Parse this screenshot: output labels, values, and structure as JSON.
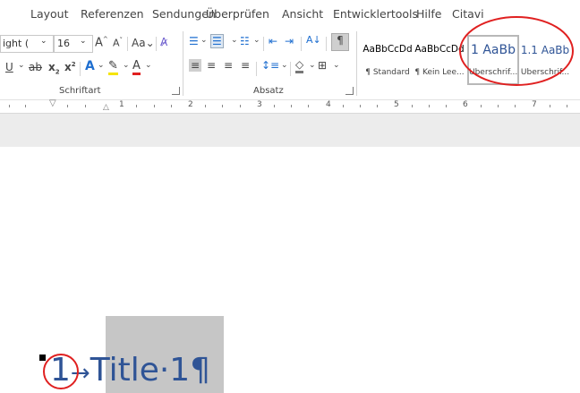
{
  "menu": {
    "tabs": [
      "Layout",
      "Referenzen",
      "Sendungen",
      "Überprüfen",
      "Ansicht",
      "Entwicklertools",
      "Hilfe",
      "Citavi"
    ]
  },
  "font": {
    "name_partial": "ight (",
    "size": "16",
    "group_label": "Schriftart"
  },
  "paragraph": {
    "group_label": "Absatz"
  },
  "styles": {
    "items": [
      {
        "preview": "AaBbCcDd",
        "name": "¶ Standard"
      },
      {
        "preview": "AaBbCcDd",
        "name": "¶ Kein Lee..."
      },
      {
        "preview": "1 AaBb",
        "name": "Überschrif..."
      },
      {
        "preview": "1.1 AaBb",
        "name": "Überschrif..."
      }
    ]
  },
  "ruler": {
    "numbers": [
      "1",
      "2",
      "3",
      "4",
      "5",
      "6",
      "7"
    ]
  },
  "document": {
    "heading_number": "1",
    "arrow": "→",
    "heading_text": "Title·1",
    "pilcrow": "¶"
  },
  "colors": {
    "annotation_red": "#e02020",
    "heading_blue": "#2f5496",
    "selection_gray": "#c6c6c6"
  }
}
